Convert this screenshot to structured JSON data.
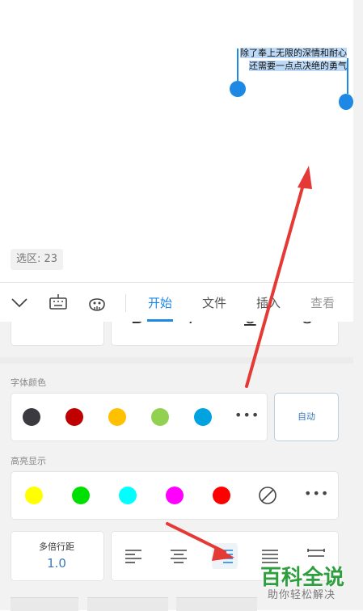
{
  "document": {
    "selected_lines": [
      "除了奉上无限的深情和耐心",
      "还需要一点点决绝的勇气"
    ],
    "selection_badge": "选区: 23"
  },
  "toolbar": {
    "icons": [
      "chevron-down-icon",
      "keyboard-icon",
      "assistant-face-icon"
    ],
    "tabs": [
      {
        "label": "开始",
        "active": true
      },
      {
        "label": "文件",
        "active": false
      },
      {
        "label": "插入",
        "active": false
      },
      {
        "label": "查看",
        "active": false
      }
    ]
  },
  "panel": {
    "font_color_label": "字体颜色",
    "font_colors": [
      "#3a3a40",
      "#c00000",
      "#ffc000",
      "#92d050",
      "#00a3e0"
    ],
    "font_color_more": "•••",
    "auto_label": "自动",
    "highlight_label": "高亮显示",
    "highlight_colors": [
      "#ffff00",
      "#00e000",
      "#00ffff",
      "#ff00ff",
      "#ff0000"
    ],
    "highlight_none_icon": "no-highlight-icon",
    "highlight_more": "•••",
    "line_spacing_label": "多倍行距",
    "line_spacing_value": "1.0",
    "alignment_icons": [
      "align-left-icon",
      "align-center-icon",
      "align-right-icon",
      "align-justify-icon",
      "distributed-align-icon"
    ],
    "alignment_active": "align-right-icon"
  },
  "watermark": {
    "title": "百科全说",
    "subtitle": "助你轻松解决"
  }
}
